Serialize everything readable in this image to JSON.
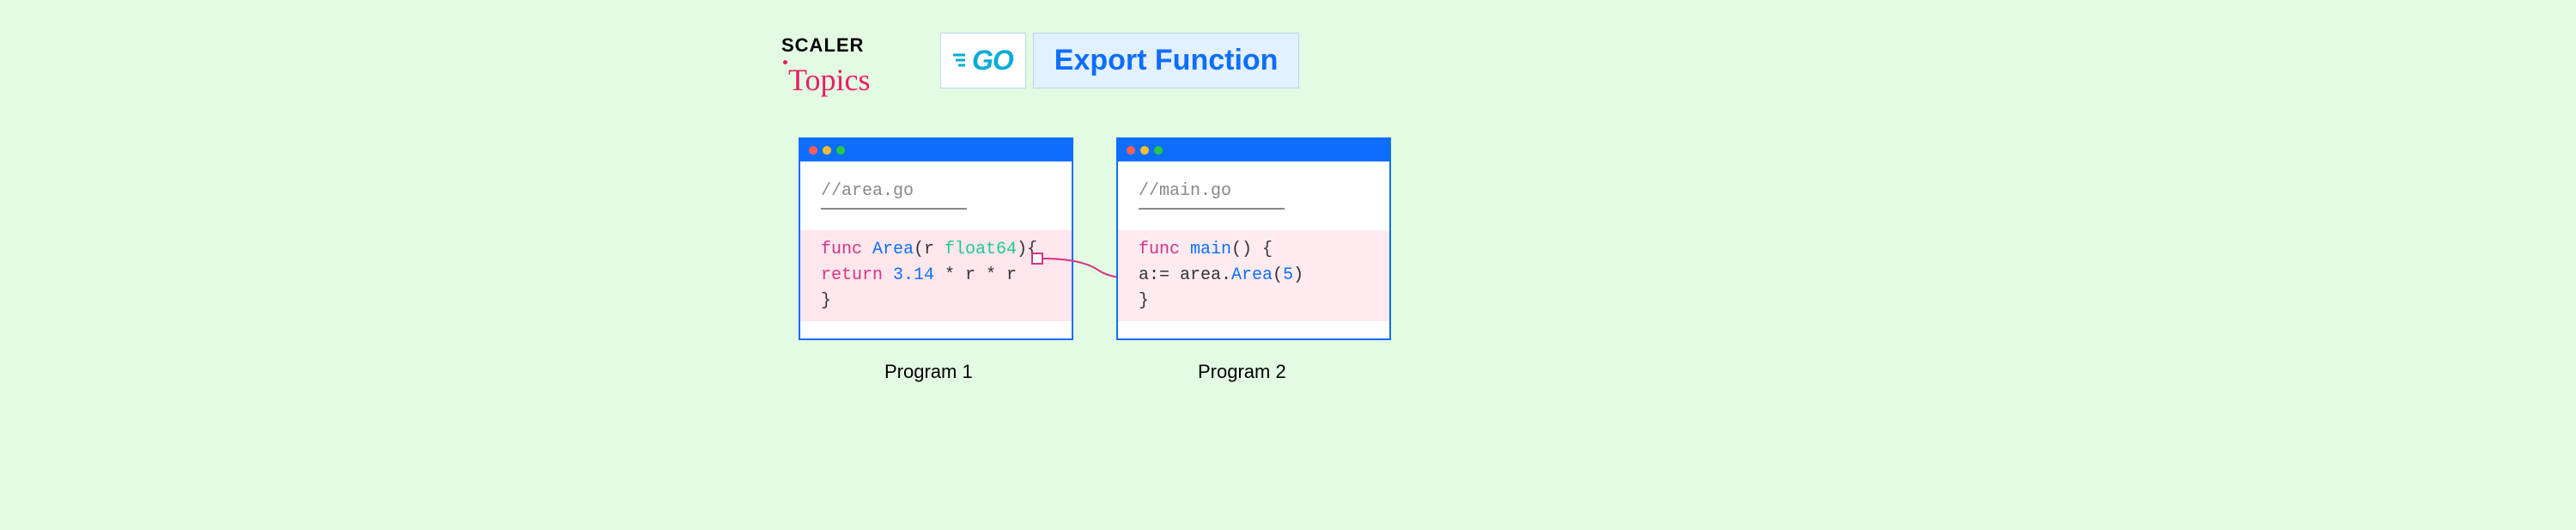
{
  "brand": {
    "scaler": "SCALER",
    "topics": "Topics"
  },
  "header": {
    "go_logo": "GO",
    "title": "Export Function"
  },
  "program1": {
    "comment": "//area.go",
    "line1_kw": "func",
    "line1_fn": " Area",
    "line1_rest": "(r ",
    "line1_ty": "float64",
    "line1_end": "){",
    "line2_kw": "return",
    "line2_num": " 3.14",
    "line2_rest": " * r * r",
    "line3": "}",
    "label": "Program 1"
  },
  "program2": {
    "comment": "//main.go",
    "line1_kw": "func",
    "line1_fn": " main",
    "line1_rest": "() {",
    "line2_var": "a:= area.",
    "line2_call": "Area",
    "line2_arg": "(",
    "line2_num": "5",
    "line2_end": ")",
    "line3": "}",
    "label": "Program 2"
  },
  "colors": {
    "bg": "#e3fae3",
    "primary": "#0d6efd",
    "highlight": "#fde6ec",
    "keyword": "#d63384"
  }
}
